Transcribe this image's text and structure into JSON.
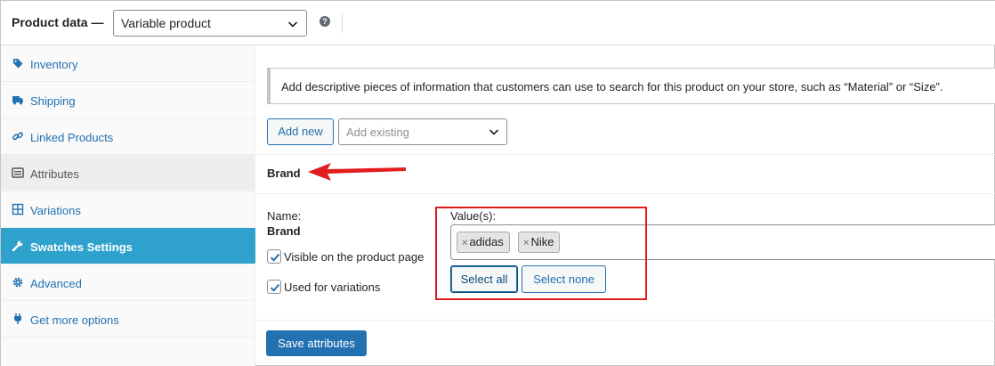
{
  "header": {
    "title": "Product data —",
    "product_type": "Variable product",
    "help_glyph": "?"
  },
  "sidebar": {
    "items": [
      {
        "label": "Inventory",
        "icon": "tag-icon"
      },
      {
        "label": "Shipping",
        "icon": "truck-icon"
      },
      {
        "label": "Linked Products",
        "icon": "link-icon"
      },
      {
        "label": "Attributes",
        "icon": "list-icon"
      },
      {
        "label": "Variations",
        "icon": "grid-icon"
      },
      {
        "label": "Swatches Settings",
        "icon": "wrench-icon"
      },
      {
        "label": "Advanced",
        "icon": "gear-icon"
      },
      {
        "label": "Get more options",
        "icon": "plugin-icon"
      }
    ],
    "active_item": "Attributes",
    "highlighted_item": "Swatches Settings"
  },
  "main": {
    "notice": "Add descriptive pieces of information that customers can use to search for this product on your store, such as “Material” or “Size”.",
    "add_new_label": "Add new",
    "add_existing_placeholder": "Add existing",
    "attribute": {
      "title": "Brand",
      "name_label": "Name:",
      "name_value": "Brand",
      "visible_label": "Visible on the product page",
      "visible_checked": true,
      "variations_label": "Used for variations",
      "variations_checked": true,
      "values_label": "Value(s):",
      "values": [
        "adidas",
        "Nike"
      ],
      "remove_glyph": "×",
      "select_all_label": "Select all",
      "select_none_label": "Select none"
    },
    "save_label": "Save attributes"
  },
  "colors": {
    "link": "#2271b1",
    "highlight_tab": "#2ea2cc",
    "annotation": "#e11d1d"
  }
}
